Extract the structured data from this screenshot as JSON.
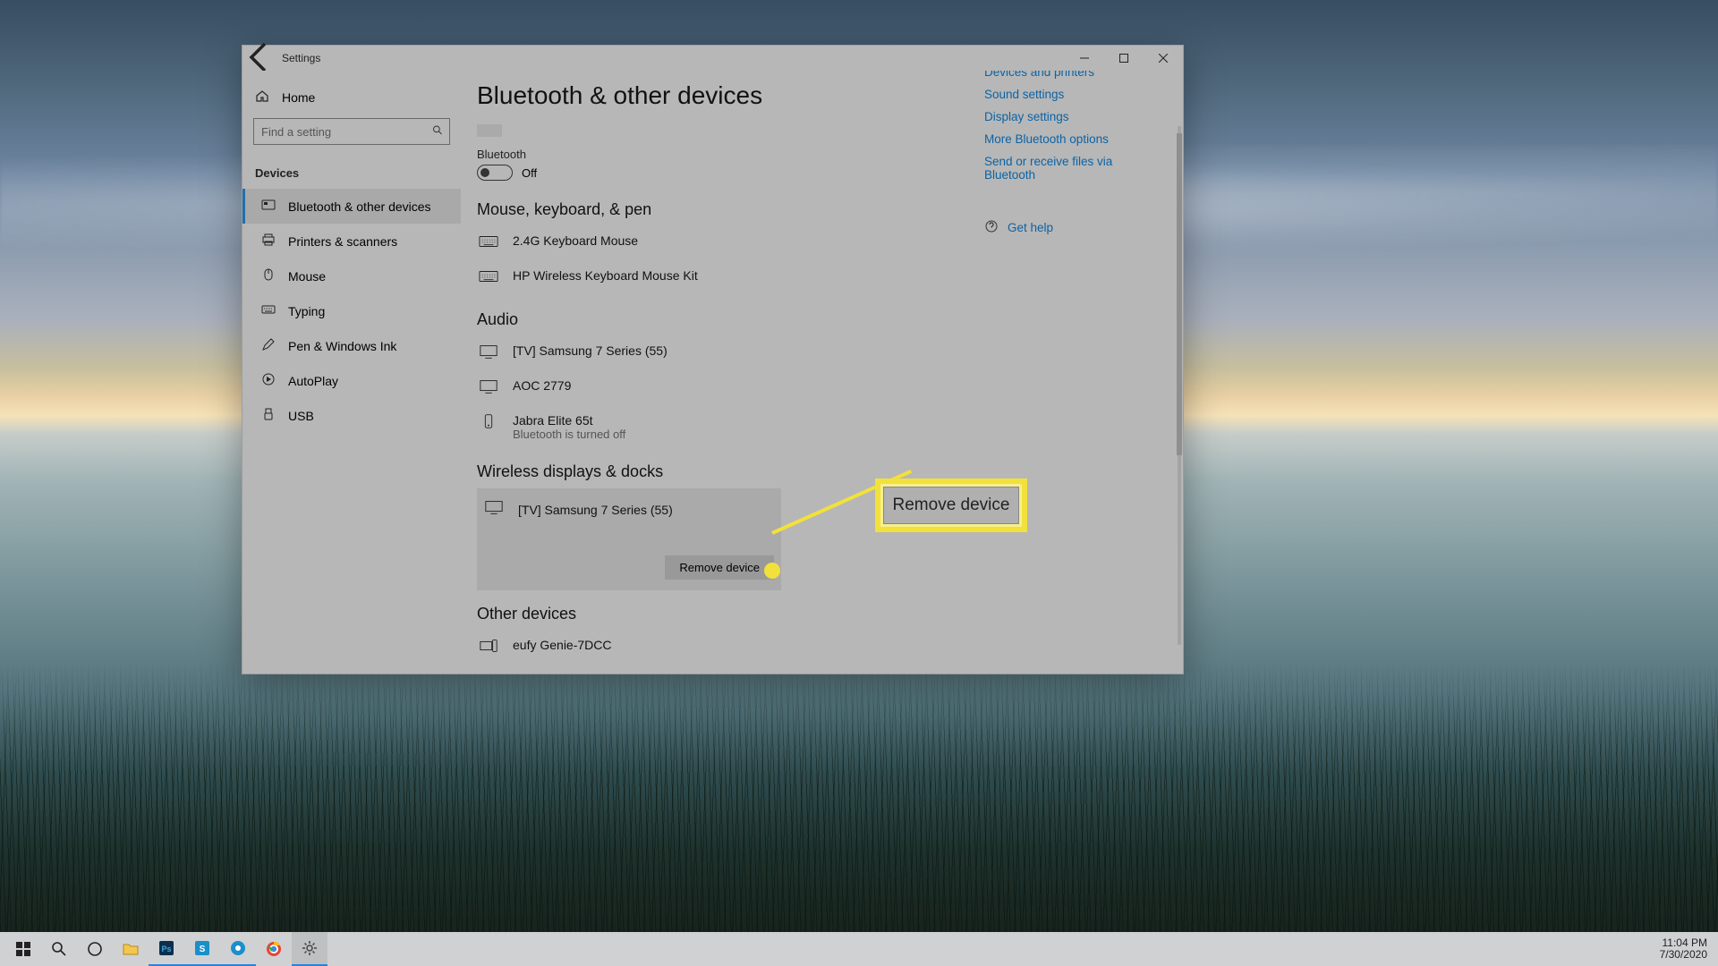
{
  "window": {
    "app_title": "Settings",
    "page_title": "Bluetooth & other devices"
  },
  "sidebar": {
    "home": "Home",
    "search_placeholder": "Find a setting",
    "section": "Devices",
    "items": [
      {
        "label": "Bluetooth & other devices"
      },
      {
        "label": "Printers & scanners"
      },
      {
        "label": "Mouse"
      },
      {
        "label": "Typing"
      },
      {
        "label": "Pen & Windows Ink"
      },
      {
        "label": "AutoPlay"
      },
      {
        "label": "USB"
      }
    ]
  },
  "bluetooth": {
    "label": "Bluetooth",
    "state": "Off"
  },
  "groups": {
    "mouse_kb": {
      "title": "Mouse, keyboard, & pen",
      "items": [
        {
          "name": "2.4G Keyboard Mouse"
        },
        {
          "name": "HP Wireless Keyboard Mouse Kit"
        }
      ]
    },
    "audio": {
      "title": "Audio",
      "items": [
        {
          "name": "[TV] Samsung 7 Series (55)"
        },
        {
          "name": "AOC 2779"
        },
        {
          "name": "Jabra Elite 65t",
          "sub": "Bluetooth is turned off"
        }
      ]
    },
    "wireless": {
      "title": "Wireless displays & docks",
      "items": [
        {
          "name": "[TV] Samsung 7 Series (55)"
        }
      ],
      "remove_label": "Remove device"
    },
    "other": {
      "title": "Other devices",
      "items": [
        {
          "name": "eufy Genie-7DCC"
        }
      ]
    }
  },
  "links": {
    "devices_printers": "Devices and printers",
    "sound": "Sound settings",
    "display": "Display settings",
    "more_bt": "More Bluetooth options",
    "send_bt": "Send or receive files via Bluetooth",
    "help": "Get help"
  },
  "callout": {
    "text": "Remove device"
  },
  "taskbar": {
    "time": "11:04 PM",
    "date": "7/30/2020"
  }
}
